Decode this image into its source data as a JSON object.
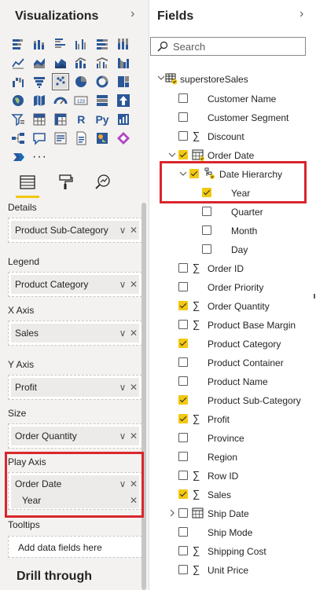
{
  "visualizations": {
    "title": "Visualizations",
    "icons": [
      [
        "stacked-bar-chart-icon",
        "stacked-column-chart-icon",
        "clustered-bar-chart-icon",
        "clustered-column-chart-icon",
        "100-stacked-bar-chart-icon",
        "100-stacked-column-chart-icon"
      ],
      [
        "line-chart-icon",
        "area-chart-icon",
        "stacked-area-chart-icon",
        "line-and-stacked-column-chart-icon",
        "line-and-clustered-column-chart-icon",
        "ribbon-chart-icon"
      ],
      [
        "waterfall-chart-icon",
        "funnel-chart-icon",
        "scatter-chart-icon",
        "pie-chart-icon",
        "donut-chart-icon",
        "treemap-icon"
      ],
      [
        "map-icon",
        "filled-map-icon",
        "gauge-icon",
        "card-icon",
        "multi-row-card-icon",
        "kpi-icon"
      ],
      [
        "slicer-icon",
        "table-icon",
        "matrix-icon",
        "r-visual-icon",
        "python-visual-icon",
        "key-influencers-icon"
      ],
      [
        "decomposition-tree-icon",
        "qa-icon",
        "smart-narrative-icon",
        "paginated-report-icon",
        "arcgis-map-icon",
        "power-apps-icon"
      ],
      [
        "power-automate-icon",
        "more-visuals-icon"
      ]
    ],
    "selected_icon": "scatter-chart-icon",
    "r_label": "R",
    "py_label": "Py",
    "tabs": [
      "build-visual-tab",
      "format-visual-tab",
      "analytics-tab"
    ],
    "wells": {
      "details": {
        "label": "Details",
        "value": "Product Sub-Category"
      },
      "legend": {
        "label": "Legend",
        "value": "Product Category"
      },
      "x_axis": {
        "label": "X Axis",
        "value": "Sales"
      },
      "y_axis": {
        "label": "Y Axis",
        "value": "Profit"
      },
      "size": {
        "label": "Size",
        "value": "Order Quantity"
      },
      "play_axis": {
        "label": "Play Axis",
        "value": "Order Date",
        "sub_value": "Year"
      },
      "tooltips": {
        "label": "Tooltips",
        "placeholder": "Add data fields here"
      }
    },
    "drill_through": "Drill through"
  },
  "fields": {
    "title": "Fields",
    "search_placeholder": "Search",
    "table_name": "superstoreSales",
    "items": [
      {
        "label": "Customer Name",
        "checked": false,
        "sigma": false
      },
      {
        "label": "Customer Segment",
        "checked": false,
        "sigma": false
      },
      {
        "label": "Discount",
        "checked": false,
        "sigma": true
      },
      {
        "label": "Order Date",
        "checked": true,
        "sigma": false,
        "calendar": true,
        "expanded": true
      },
      {
        "label": "Date Hierarchy",
        "checked": true,
        "hierarchy": true,
        "expanded": true
      },
      {
        "label": "Year",
        "checked": true
      },
      {
        "label": "Quarter",
        "checked": false
      },
      {
        "label": "Month",
        "checked": false
      },
      {
        "label": "Day",
        "checked": false
      },
      {
        "label": "Order ID",
        "checked": false,
        "sigma": true
      },
      {
        "label": "Order Priority",
        "checked": false,
        "sigma": false
      },
      {
        "label": "Order Quantity",
        "checked": true,
        "sigma": true
      },
      {
        "label": "Product Base Margin",
        "checked": false,
        "sigma": true
      },
      {
        "label": "Product Category",
        "checked": true,
        "sigma": false
      },
      {
        "label": "Product Container",
        "checked": false,
        "sigma": false
      },
      {
        "label": "Product Name",
        "checked": false,
        "sigma": false
      },
      {
        "label": "Product Sub-Category",
        "checked": true,
        "sigma": false
      },
      {
        "label": "Profit",
        "checked": true,
        "sigma": true
      },
      {
        "label": "Province",
        "checked": false,
        "sigma": false
      },
      {
        "label": "Region",
        "checked": false,
        "sigma": false
      },
      {
        "label": "Row ID",
        "checked": false,
        "sigma": true
      },
      {
        "label": "Sales",
        "checked": true,
        "sigma": true
      },
      {
        "label": "Ship Date",
        "checked": false,
        "calendar": true,
        "expanded": false
      },
      {
        "label": "Ship Mode",
        "checked": false,
        "sigma": false
      },
      {
        "label": "Shipping Cost",
        "checked": false,
        "sigma": true
      },
      {
        "label": "Unit Price",
        "checked": false,
        "sigma": true
      }
    ]
  },
  "colors": {
    "accent_yellow": "#f2c811",
    "highlight_red": "#d9262c",
    "pane_bg": "#f3f2f1",
    "chip_bg": "#edebe9"
  }
}
